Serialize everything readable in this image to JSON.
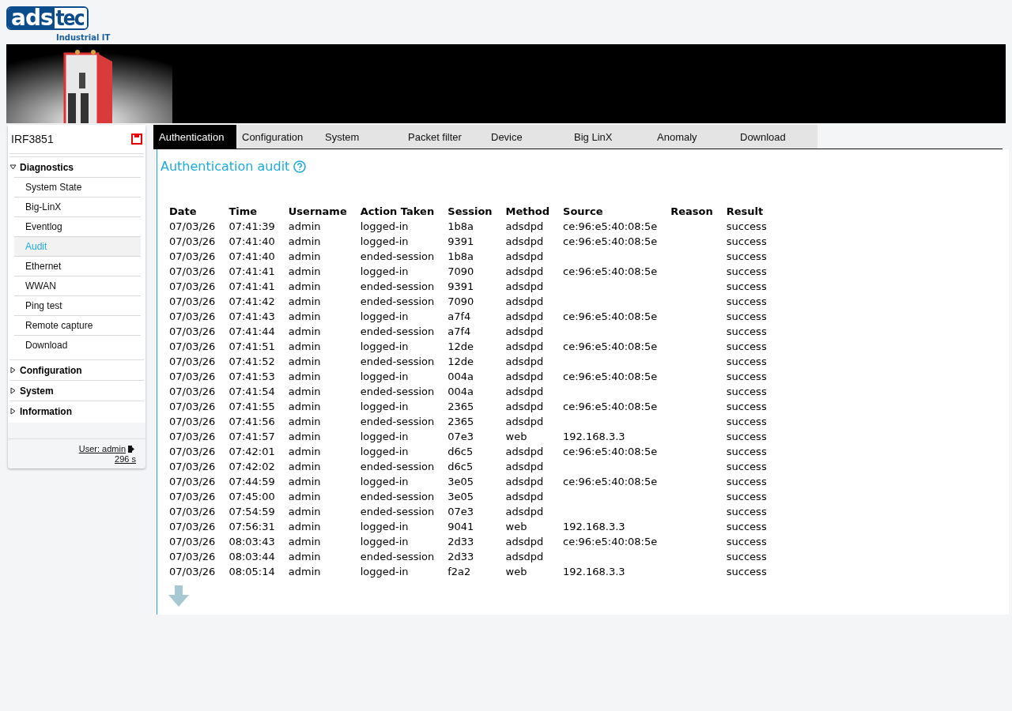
{
  "logo": {
    "part_1": "ads",
    "part_2": "tec",
    "tagline": "Industrial IT"
  },
  "sidebar": {
    "device": "IRF3851",
    "sections": [
      {
        "label": "Diagnostics",
        "expanded": true,
        "children": [
          {
            "label": "System State",
            "selected": false
          },
          {
            "label": "Big-LinX",
            "selected": false
          },
          {
            "label": "Eventlog",
            "selected": false
          },
          {
            "label": "Audit",
            "selected": true
          },
          {
            "label": "Ethernet",
            "selected": false
          },
          {
            "label": "WWAN",
            "selected": false
          },
          {
            "label": "Ping test",
            "selected": false
          },
          {
            "label": "Remote capture",
            "selected": false
          },
          {
            "label": "Download",
            "selected": false
          }
        ]
      },
      {
        "label": "Configuration",
        "expanded": false
      },
      {
        "label": "System",
        "expanded": false
      },
      {
        "label": "Information",
        "expanded": false
      }
    ],
    "user": "User: admin",
    "timer": "296 s"
  },
  "tabs": [
    {
      "label": "Authentication",
      "selected": true
    },
    {
      "label": "Configuration",
      "selected": false
    },
    {
      "label": "System",
      "selected": false
    },
    {
      "label": "Packet filter",
      "selected": false
    },
    {
      "label": "Device",
      "selected": false
    },
    {
      "label": "Big LinX",
      "selected": false
    },
    {
      "label": "Anomaly",
      "selected": false
    },
    {
      "label": "Download",
      "selected": false
    }
  ],
  "title": "Authentication audit",
  "table": {
    "columns": [
      "Date",
      "Time",
      "Username",
      "Action Taken",
      "Session",
      "Method",
      "Source",
      "Reason",
      "Result"
    ],
    "rows": [
      [
        "07/03/26",
        "07:41:39",
        "admin",
        "logged-in",
        "1b8a",
        "adsdpd",
        "ce:96:e5:40:08:5e",
        "",
        "success"
      ],
      [
        "07/03/26",
        "07:41:40",
        "admin",
        "logged-in",
        "9391",
        "adsdpd",
        "ce:96:e5:40:08:5e",
        "",
        "success"
      ],
      [
        "07/03/26",
        "07:41:40",
        "admin",
        "ended-session",
        "1b8a",
        "adsdpd",
        "",
        "",
        "success"
      ],
      [
        "07/03/26",
        "07:41:41",
        "admin",
        "logged-in",
        "7090",
        "adsdpd",
        "ce:96:e5:40:08:5e",
        "",
        "success"
      ],
      [
        "07/03/26",
        "07:41:41",
        "admin",
        "ended-session",
        "9391",
        "adsdpd",
        "",
        "",
        "success"
      ],
      [
        "07/03/26",
        "07:41:42",
        "admin",
        "ended-session",
        "7090",
        "adsdpd",
        "",
        "",
        "success"
      ],
      [
        "07/03/26",
        "07:41:43",
        "admin",
        "logged-in",
        "a7f4",
        "adsdpd",
        "ce:96:e5:40:08:5e",
        "",
        "success"
      ],
      [
        "07/03/26",
        "07:41:44",
        "admin",
        "ended-session",
        "a7f4",
        "adsdpd",
        "",
        "",
        "success"
      ],
      [
        "07/03/26",
        "07:41:51",
        "admin",
        "logged-in",
        "12de",
        "adsdpd",
        "ce:96:e5:40:08:5e",
        "",
        "success"
      ],
      [
        "07/03/26",
        "07:41:52",
        "admin",
        "ended-session",
        "12de",
        "adsdpd",
        "",
        "",
        "success"
      ],
      [
        "07/03/26",
        "07:41:53",
        "admin",
        "logged-in",
        "004a",
        "adsdpd",
        "ce:96:e5:40:08:5e",
        "",
        "success"
      ],
      [
        "07/03/26",
        "07:41:54",
        "admin",
        "ended-session",
        "004a",
        "adsdpd",
        "",
        "",
        "success"
      ],
      [
        "07/03/26",
        "07:41:55",
        "admin",
        "logged-in",
        "2365",
        "adsdpd",
        "ce:96:e5:40:08:5e",
        "",
        "success"
      ],
      [
        "07/03/26",
        "07:41:56",
        "admin",
        "ended-session",
        "2365",
        "adsdpd",
        "",
        "",
        "success"
      ],
      [
        "07/03/26",
        "07:41:57",
        "admin",
        "logged-in",
        "07e3",
        "web",
        "192.168.3.3",
        "",
        "success"
      ],
      [
        "07/03/26",
        "07:42:01",
        "admin",
        "logged-in",
        "d6c5",
        "adsdpd",
        "ce:96:e5:40:08:5e",
        "",
        "success"
      ],
      [
        "07/03/26",
        "07:42:02",
        "admin",
        "ended-session",
        "d6c5",
        "adsdpd",
        "",
        "",
        "success"
      ],
      [
        "07/03/26",
        "07:44:59",
        "admin",
        "logged-in",
        "3e05",
        "adsdpd",
        "ce:96:e5:40:08:5e",
        "",
        "success"
      ],
      [
        "07/03/26",
        "07:45:00",
        "admin",
        "ended-session",
        "3e05",
        "adsdpd",
        "",
        "",
        "success"
      ],
      [
        "07/03/26",
        "07:54:59",
        "admin",
        "ended-session",
        "07e3",
        "adsdpd",
        "",
        "",
        "success"
      ],
      [
        "07/03/26",
        "07:56:31",
        "admin",
        "logged-in",
        "9041",
        "web",
        "192.168.3.3",
        "",
        "success"
      ],
      [
        "07/03/26",
        "08:03:43",
        "admin",
        "logged-in",
        "2d33",
        "adsdpd",
        "ce:96:e5:40:08:5e",
        "",
        "success"
      ],
      [
        "07/03/26",
        "08:03:44",
        "admin",
        "ended-session",
        "2d33",
        "adsdpd",
        "",
        "",
        "success"
      ],
      [
        "07/03/26",
        "08:05:14",
        "admin",
        "logged-in",
        "f2a2",
        "web",
        "192.168.3.3",
        "",
        "success"
      ]
    ]
  }
}
